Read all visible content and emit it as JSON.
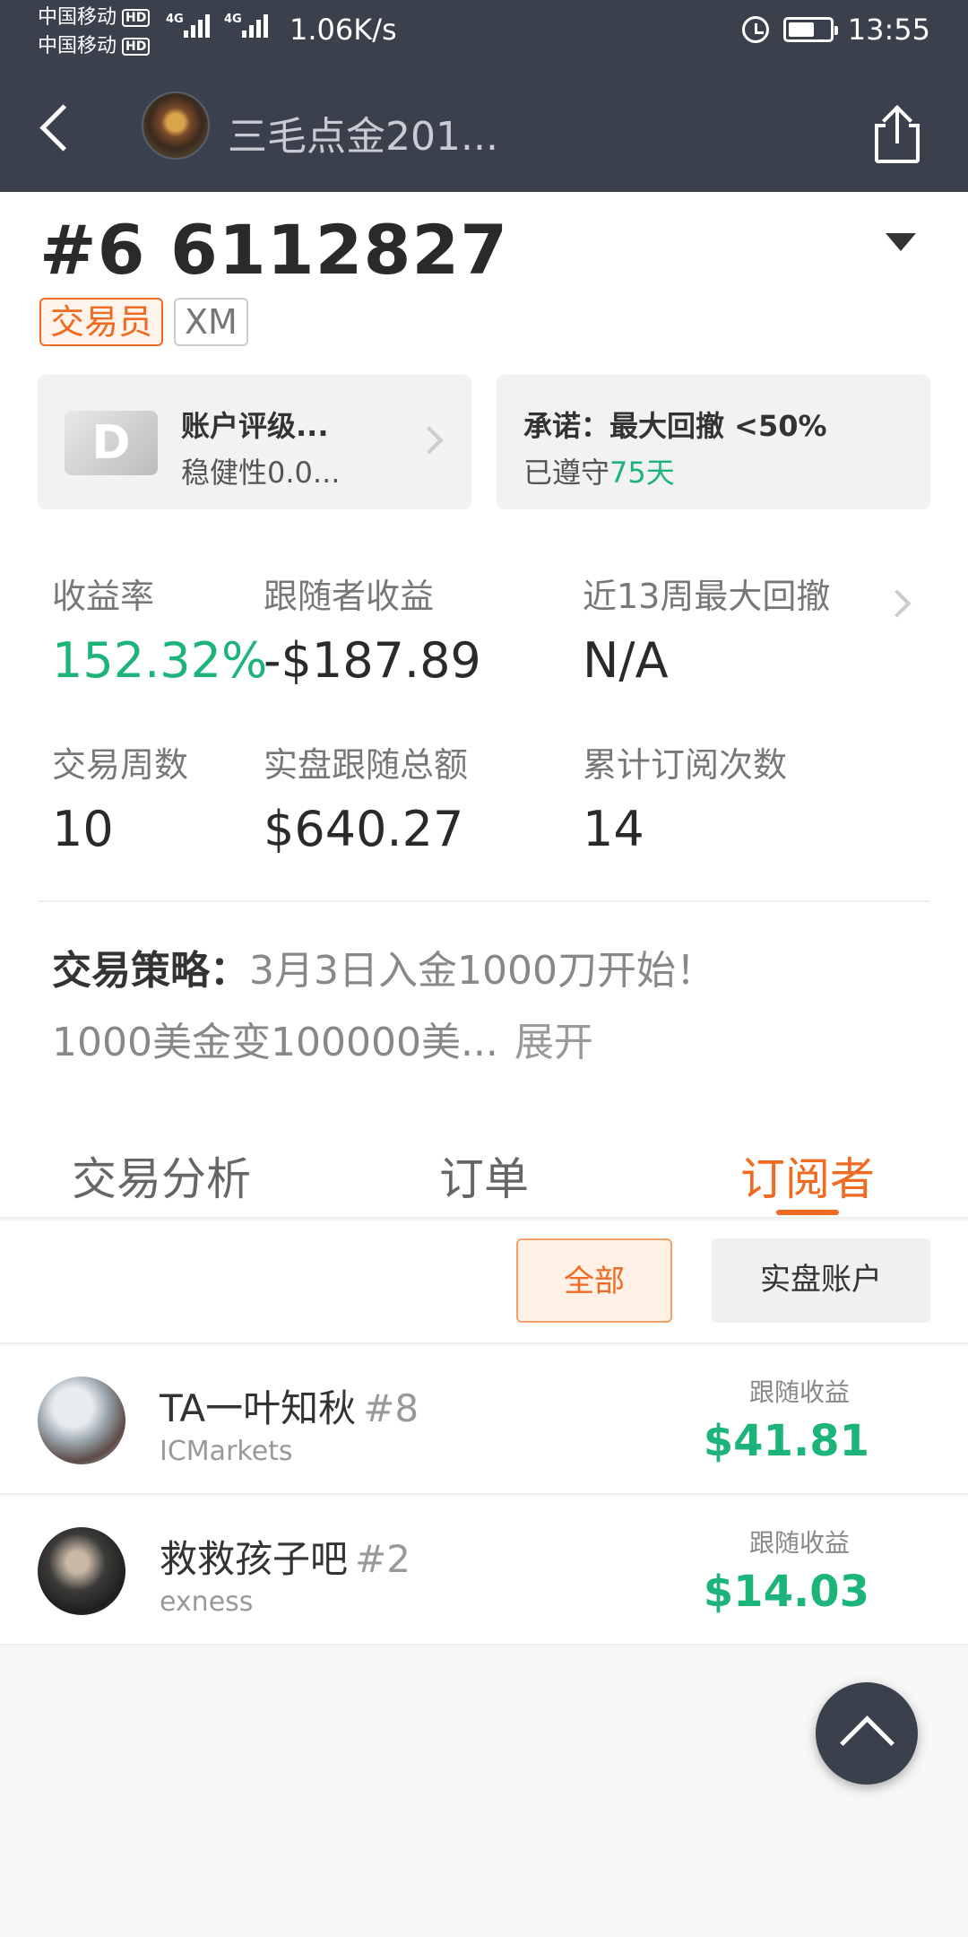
{
  "status_bar": {
    "carrier_1": "中国移动",
    "carrier_2": "中国移动",
    "hd_label": "HD",
    "network_1": "4G",
    "network_2": "4G",
    "speed": "1.06K/s",
    "time": "13:55"
  },
  "nav": {
    "title": "三毛点金201..."
  },
  "account": {
    "id": "#6 6112827",
    "role_tag": "交易员",
    "broker_tag": "XM"
  },
  "rating_card": {
    "grade": "D",
    "title": "账户评级...",
    "subtitle": "稳健性0.0..."
  },
  "commit_card": {
    "title": "承诺：最大回撤 <50%",
    "kept_prefix": "已遵守",
    "kept_days": "75天"
  },
  "stats": {
    "return_label": "收益率",
    "return_value": "152.32%",
    "follower_profit_label": "跟随者收益",
    "follower_profit_value": "-$187.89",
    "drawdown_label": "近13周最大回撤",
    "drawdown_value": "N/A",
    "weeks_label": "交易周数",
    "weeks_value": "10",
    "follow_total_label": "实盘跟随总额",
    "follow_total_value": "$640.27",
    "subs_label": "累计订阅次数",
    "subs_value": "14"
  },
  "strategy": {
    "label": "交易策略：",
    "line1": "3月3日入金1000刀开始！",
    "line2": "1000美金变100000美...",
    "expand": "展开"
  },
  "tabs": {
    "analysis": "交易分析",
    "orders": "订单",
    "subscribers": "订阅者"
  },
  "filters": {
    "all": "全部",
    "real": "实盘账户"
  },
  "subscribers": [
    {
      "name": "TA一叶知秋",
      "rank": "#8",
      "broker": "ICMarkets",
      "profit_label": "跟随收益",
      "profit": "$41.81"
    },
    {
      "name": "救救孩子吧",
      "rank": "#2",
      "broker": "exness",
      "profit_label": "跟随收益",
      "profit": "$14.03"
    }
  ],
  "colors": {
    "accent": "#f06a21",
    "positive": "#1db47a",
    "header_bg": "#3b414c"
  },
  "icons": [
    "back-arrow-icon",
    "share-icon",
    "dropdown-caret-icon",
    "chevron-right-icon",
    "scroll-to-top-icon",
    "alarm-icon",
    "battery-icon",
    "signal-icon"
  ]
}
